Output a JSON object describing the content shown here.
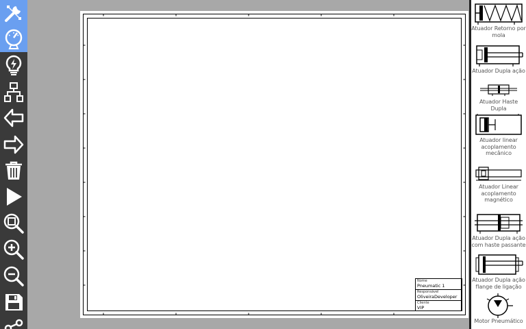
{
  "toolbar": {
    "tools": [
      {
        "name": "tools-icon",
        "active": true
      },
      {
        "name": "gauge-icon",
        "active": true
      },
      {
        "name": "electric-bulb-icon",
        "active": false
      },
      {
        "name": "connection-icon",
        "active": false
      },
      {
        "name": "arrow-left-icon",
        "active": false
      },
      {
        "name": "arrow-right-icon",
        "active": false
      },
      {
        "name": "trash-icon",
        "active": false
      },
      {
        "name": "play-icon",
        "active": false
      },
      {
        "name": "zoom-fit-icon",
        "active": false
      },
      {
        "name": "zoom-in-icon",
        "active": false
      },
      {
        "name": "zoom-out-icon",
        "active": false
      },
      {
        "name": "save-icon",
        "active": false
      },
      {
        "name": "share-icon",
        "active": false
      }
    ],
    "active_color": "#6a9ff0",
    "background": "#3a3a3a"
  },
  "sheet": {
    "title_block": {
      "name_label": "Nome",
      "name_value": "Pneumatic 1",
      "responsible_label": "Responsável",
      "responsible_value": "OliveiraDeveloper",
      "client_label": "Cliente",
      "client_value": "VIP"
    }
  },
  "palette": {
    "components": [
      {
        "id": "spring-return",
        "label": "Atuador Retorno por mola"
      },
      {
        "id": "double-acting",
        "label": "Atuador Dupla ação"
      },
      {
        "id": "double-rod",
        "label": "Atuador Haste Dupla"
      },
      {
        "id": "linear-mechanical",
        "label": "Atuador linear acoplamento mecânico"
      },
      {
        "id": "linear-magnetic",
        "label": "Atuador Linear acoplamento magnético"
      },
      {
        "id": "double-acting-through-rod",
        "label": "Atuador Dupla ação com haste passante"
      },
      {
        "id": "double-acting-flange",
        "label": "Atuador Dupla ação flange de ligação"
      },
      {
        "id": "pneumatic-motor",
        "label": "Motor Pneumático"
      }
    ]
  }
}
